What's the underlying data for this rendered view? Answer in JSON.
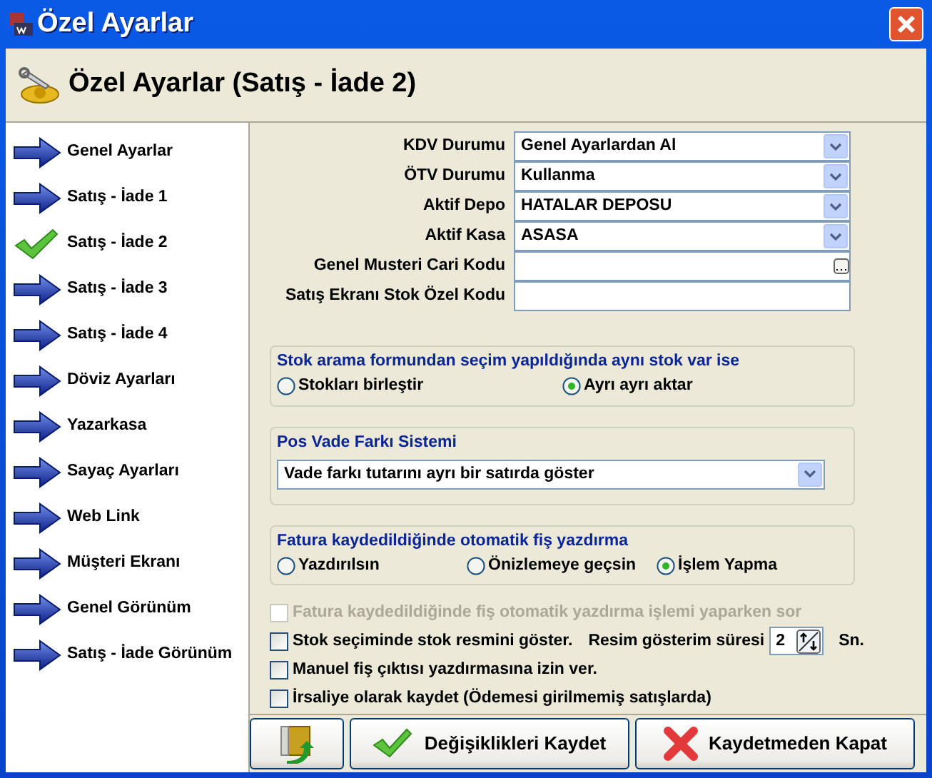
{
  "window": {
    "title": "Özel Ayarlar"
  },
  "header": {
    "title": "Özel Ayarlar (Satış - İade 2)"
  },
  "sidebar": {
    "items": [
      {
        "label": "Genel Ayarlar",
        "selected": false
      },
      {
        "label": "Satış - İade 1",
        "selected": false
      },
      {
        "label": "Satış - İade 2",
        "selected": true
      },
      {
        "label": "Satış - İade 3",
        "selected": false
      },
      {
        "label": "Satış - İade 4",
        "selected": false
      },
      {
        "label": "Döviz Ayarları",
        "selected": false
      },
      {
        "label": "Yazarkasa",
        "selected": false
      },
      {
        "label": "Sayaç Ayarları",
        "selected": false
      },
      {
        "label": "Web Link",
        "selected": false
      },
      {
        "label": "Müşteri Ekranı",
        "selected": false
      },
      {
        "label": "Genel Görünüm",
        "selected": false
      },
      {
        "label": "Satış - İade Görünüm",
        "selected": false
      }
    ]
  },
  "fields": [
    {
      "label": "KDV Durumu",
      "kind": "dropdown",
      "value": "Genel Ayarlardan Al"
    },
    {
      "label": "ÖTV Durumu",
      "kind": "dropdown",
      "value": "Kullanma"
    },
    {
      "label": "Aktif Depo",
      "kind": "dropdown",
      "value": "HATALAR DEPOSU"
    },
    {
      "label": "Aktif Kasa",
      "kind": "dropdown",
      "value": "ASASA"
    },
    {
      "label": "Genel Musteri Cari Kodu",
      "kind": "lookup"
    },
    {
      "label": "Satış Ekranı Stok Özel Kodu",
      "kind": "text"
    }
  ],
  "groups": [
    {
      "title": "Stok arama formundan seçim yapıldığında aynı stok var ise",
      "kind": "radios",
      "options": [
        {
          "label": "Stokları birleştir",
          "selected": false
        },
        {
          "label": "Ayrı ayrı aktar",
          "selected": true
        }
      ]
    },
    {
      "title": "Pos Vade Farkı Sistemi",
      "kind": "dropdown",
      "value": "Vade farkı tutarını ayrı bir satırda göster"
    },
    {
      "title": "Fatura kaydedildiğinde otomatik fiş yazdırma",
      "kind": "radios",
      "options": [
        {
          "label": "Yazdırılsın",
          "selected": false
        },
        {
          "label": "Önizlemeye geçsin",
          "selected": false
        },
        {
          "label": "İşlem Yapma",
          "selected": true
        }
      ]
    }
  ],
  "checkboxes": [
    {
      "label": "Fatura kaydedildiğinde fiş otomatik yazdırma işlemi yaparken sor",
      "checked": false,
      "disabled": true
    },
    {
      "label": "Stok seçiminde stok resmini göster.",
      "checked": false,
      "disabled": false,
      "extra": {
        "label": "Resim gösterim süresi",
        "value": "2",
        "unit": "Sn."
      }
    },
    {
      "label": "Manuel fiş çıktısı yazdırmasına izin ver.",
      "checked": false,
      "disabled": false
    },
    {
      "label": "İrsaliye olarak kaydet (Ödemesi girilmemiş satışlarda)",
      "checked": false,
      "disabled": false
    }
  ],
  "buttons": [
    {
      "kind": "exit"
    },
    {
      "kind": "save",
      "label": "Değişiklikleri Kaydet"
    },
    {
      "kind": "cancel",
      "label": "Kaydetmeden Kapat"
    }
  ]
}
